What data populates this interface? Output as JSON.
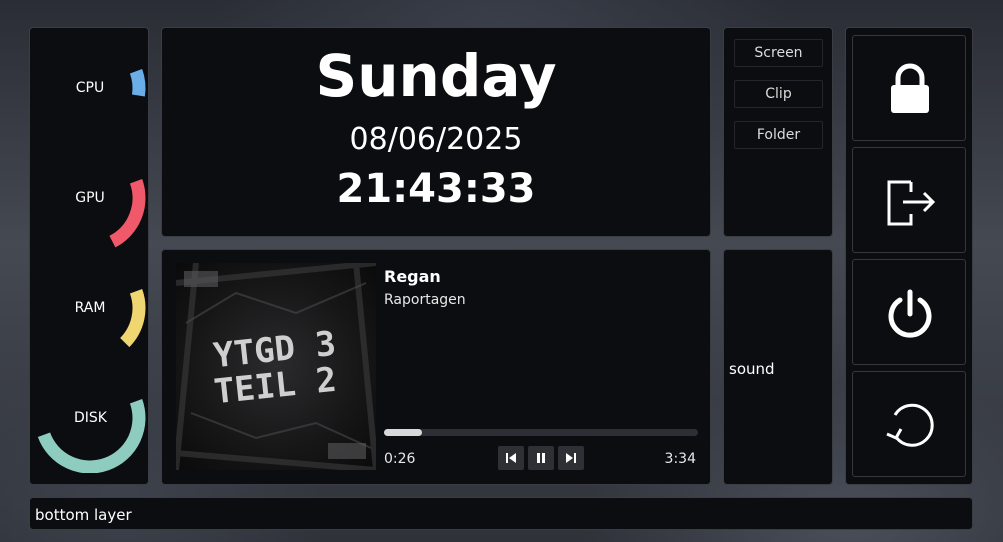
{
  "sidebar": {
    "meters": [
      {
        "label": "CPU",
        "value": 0.08,
        "color": "#6aaee8"
      },
      {
        "label": "GPU",
        "value": 0.23,
        "color": "#f0596a"
      },
      {
        "label": "RAM",
        "value": 0.18,
        "color": "#f0d670"
      },
      {
        "label": "DISK",
        "value": 0.5,
        "color": "#8fccc0"
      }
    ]
  },
  "clock": {
    "day": "Sunday",
    "date": "08/06/2025",
    "time": "21:43:33"
  },
  "shortcuts": {
    "items": [
      "Screen",
      "Clip",
      "Folder"
    ]
  },
  "power": {
    "items": [
      "lock-icon",
      "logout-icon",
      "power-icon",
      "restart-icon"
    ]
  },
  "player": {
    "title": "Regan",
    "artist": "Raportagen",
    "position": "0:26",
    "duration": "3:34",
    "progress": 0.12,
    "album_art_text": [
      "YTGD 3",
      "TEIL 2"
    ]
  },
  "sound": {
    "label": "sound"
  },
  "bottom": {
    "label": "bottom layer"
  }
}
